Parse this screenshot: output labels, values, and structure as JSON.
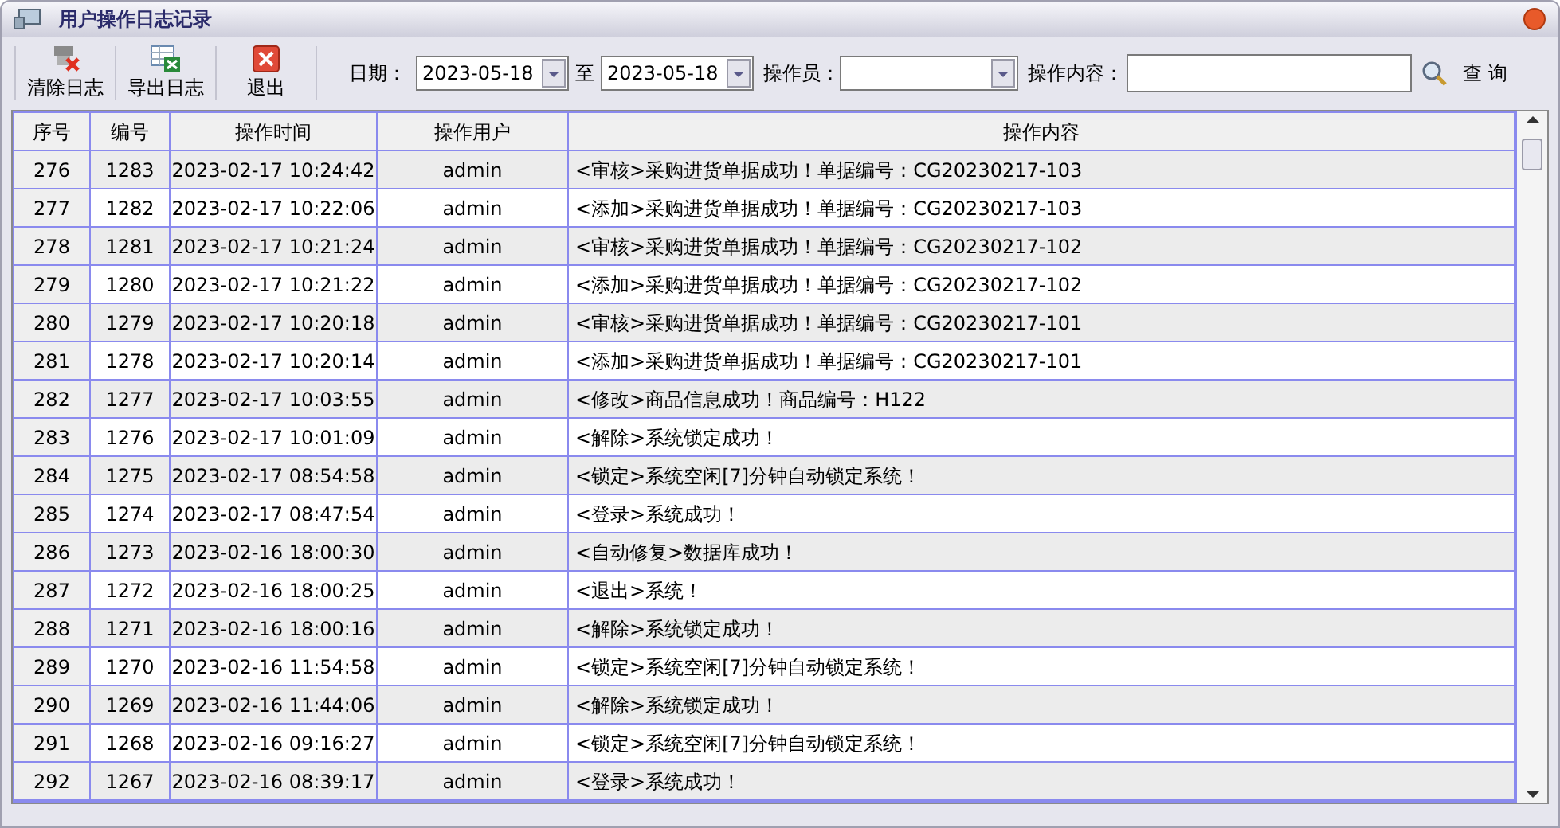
{
  "window": {
    "title": "用户操作日志记录"
  },
  "toolbar": {
    "buttons": [
      {
        "label": "清除日志",
        "kind": "clear"
      },
      {
        "label": "导出日志",
        "kind": "export"
      },
      {
        "label": "退出",
        "kind": "exit"
      }
    ],
    "date_label": "日期：",
    "date_from": "2023-05-18",
    "date_sep": "至",
    "date_to": "2023-05-18",
    "operator_label": "操作员：",
    "content_label": "操作内容：",
    "search_label": "查 询"
  },
  "table": {
    "columns": [
      "序号",
      "编号",
      "操作时间",
      "操作用户",
      "操作内容"
    ],
    "rows": [
      [
        "276",
        "1283",
        "2023-02-17 10:24:42",
        "admin",
        "<审核>采购进货单据成功！单据编号：CG20230217-103"
      ],
      [
        "277",
        "1282",
        "2023-02-17 10:22:06",
        "admin",
        "<添加>采购进货单据成功！单据编号：CG20230217-103"
      ],
      [
        "278",
        "1281",
        "2023-02-17 10:21:24",
        "admin",
        "<审核>采购进货单据成功！单据编号：CG20230217-102"
      ],
      [
        "279",
        "1280",
        "2023-02-17 10:21:22",
        "admin",
        "<添加>采购进货单据成功！单据编号：CG20230217-102"
      ],
      [
        "280",
        "1279",
        "2023-02-17 10:20:18",
        "admin",
        "<审核>采购进货单据成功！单据编号：CG20230217-101"
      ],
      [
        "281",
        "1278",
        "2023-02-17 10:20:14",
        "admin",
        "<添加>采购进货单据成功！单据编号：CG20230217-101"
      ],
      [
        "282",
        "1277",
        "2023-02-17 10:03:55",
        "admin",
        "<修改>商品信息成功！商品编号：H122"
      ],
      [
        "283",
        "1276",
        "2023-02-17 10:01:09",
        "admin",
        "<解除>系统锁定成功！"
      ],
      [
        "284",
        "1275",
        "2023-02-17 08:54:58",
        "admin",
        "<锁定>系统空闲[7]分钟自动锁定系统！"
      ],
      [
        "285",
        "1274",
        "2023-02-17 08:47:54",
        "admin",
        "<登录>系统成功！"
      ],
      [
        "286",
        "1273",
        "2023-02-16 18:00:30",
        "admin",
        "<自动修复>数据库成功！"
      ],
      [
        "287",
        "1272",
        "2023-02-16 18:00:25",
        "admin",
        "<退出>系统！"
      ],
      [
        "288",
        "1271",
        "2023-02-16 18:00:16",
        "admin",
        "<解除>系统锁定成功！"
      ],
      [
        "289",
        "1270",
        "2023-02-16 11:54:58",
        "admin",
        "<锁定>系统空闲[7]分钟自动锁定系统！"
      ],
      [
        "290",
        "1269",
        "2023-02-16 11:44:06",
        "admin",
        "<解除>系统锁定成功！"
      ],
      [
        "291",
        "1268",
        "2023-02-16 09:16:27",
        "admin",
        "<锁定>系统空闲[7]分钟自动锁定系统！"
      ],
      [
        "292",
        "1267",
        "2023-02-16 08:39:17",
        "admin",
        "<登录>系统成功！"
      ]
    ]
  }
}
